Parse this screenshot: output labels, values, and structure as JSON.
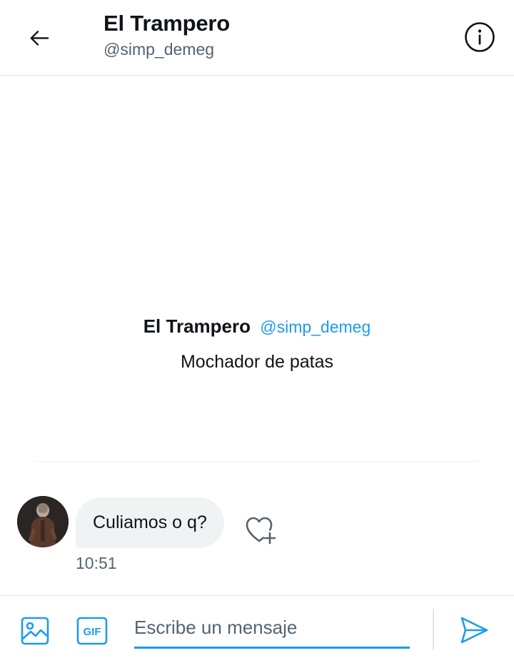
{
  "header": {
    "title": "El Trampero",
    "handle": "@simp_demeg",
    "back_icon": "arrow-left-icon",
    "info_icon": "info-icon"
  },
  "profile": {
    "name": "El Trampero",
    "handle": "@simp_demeg",
    "bio": "Mochador de patas"
  },
  "messages": [
    {
      "text": "Culiamos o q?",
      "time": "10:51",
      "avatar_icon": "avatar",
      "reaction_icon": "heart-plus-icon"
    }
  ],
  "composer": {
    "placeholder": "Escribe un mensaje",
    "media_icon": "image-icon",
    "gif_icon": "gif-icon",
    "gif_label": "GIF",
    "send_icon": "send-icon"
  },
  "colors": {
    "accent": "#1d9bf0",
    "text": "#0f1419",
    "secondary": "#536471",
    "bubble": "#eff3f4",
    "border": "#e3e7ea"
  }
}
